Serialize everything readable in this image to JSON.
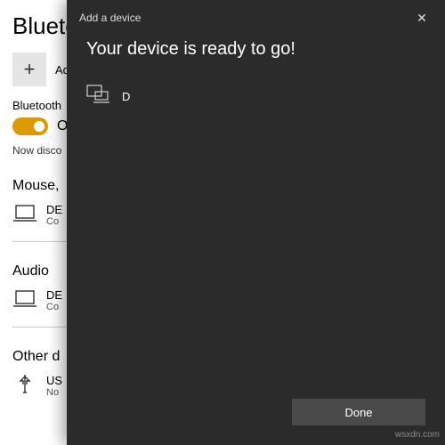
{
  "bg": {
    "title": "Blueto",
    "add_label": "Ad",
    "sub_heading": "Bluetooth",
    "toggle_state": "O",
    "discover_status": "Now disco",
    "categories": {
      "mouse": {
        "head": "Mouse,",
        "dev_name": "DE",
        "dev_sub": "Co"
      },
      "audio": {
        "head": "Audio",
        "dev_name": "DE",
        "dev_sub": "Co"
      },
      "other": {
        "head": "Other d",
        "dev_name": "US",
        "dev_sub": "No"
      }
    }
  },
  "modal": {
    "header_title": "Add a device",
    "ready_msg": "Your device is ready to go!",
    "device_label": "D",
    "done_label": "Done"
  },
  "watermark": "wsxdn.com"
}
